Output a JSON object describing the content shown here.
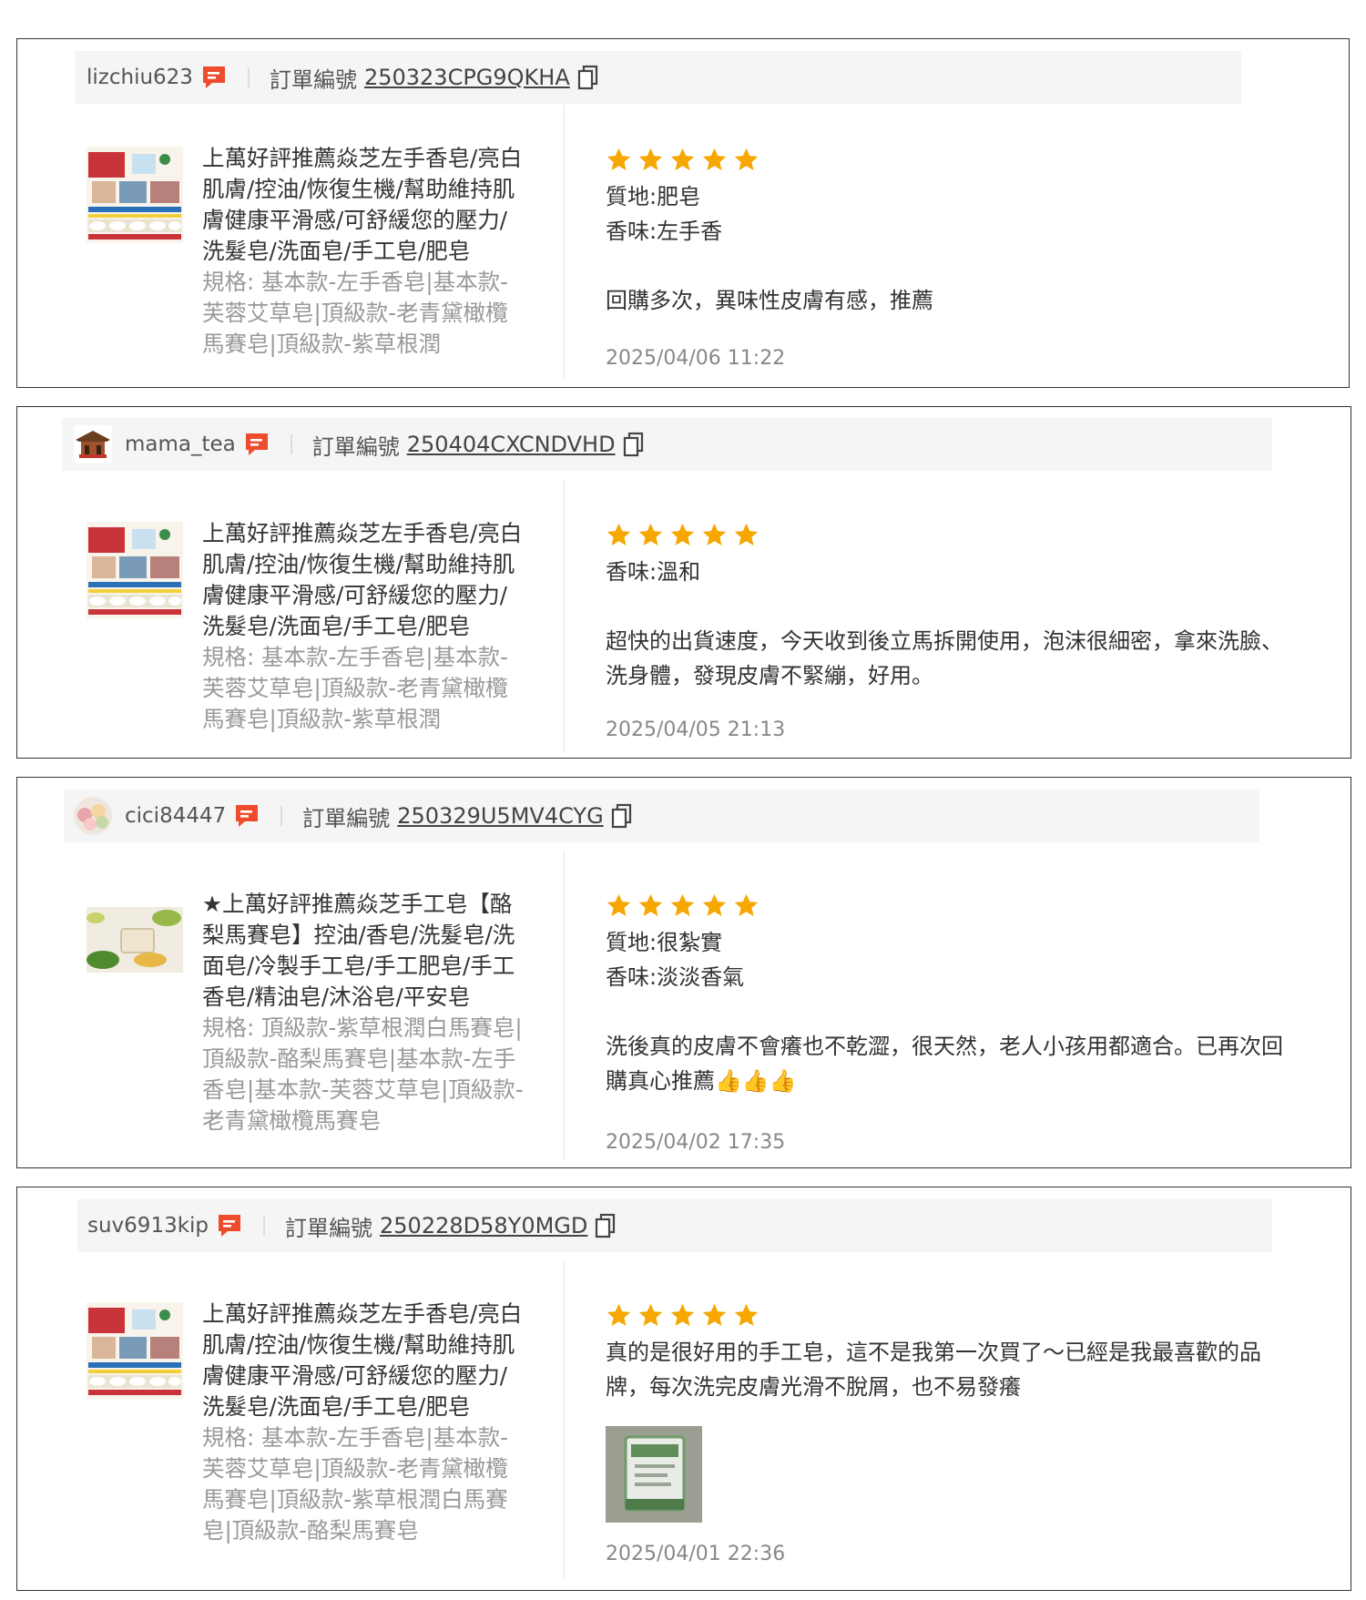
{
  "common": {
    "order_label": "訂單編號",
    "spec_prefix": "規格: "
  },
  "reviews": [
    {
      "username": "lizchiu623",
      "order_no": "250323CPG9QKHA",
      "product_title": "上萬好評推薦焱芝左手香皂/亮白肌膚/控油/恢復生機/幫助維持肌膚健康平滑感/可舒緩您的壓力/洗髮皂/洗面皂/手工皂/肥皂",
      "product_spec": "規格: 基本款-左手香皂|基本款-芙蓉艾草皂|頂級款-老青黛橄欖馬賽皂|頂級款-紫草根潤",
      "rating": 5,
      "attrs": [
        "質地:肥皂",
        "香味:左手香"
      ],
      "text": "回購多次，異味性皮膚有感，推薦",
      "date": "2025/04/06 11:22"
    },
    {
      "username": "mama_tea",
      "order_no": "250404CXCNDVHD",
      "product_title": "上萬好評推薦焱芝左手香皂/亮白肌膚/控油/恢復生機/幫助維持肌膚健康平滑感/可舒緩您的壓力/洗髮皂/洗面皂/手工皂/肥皂",
      "product_spec": "規格: 基本款-左手香皂|基本款-芙蓉艾草皂|頂級款-老青黛橄欖馬賽皂|頂級款-紫草根潤",
      "rating": 5,
      "attrs": [
        "香味:溫和"
      ],
      "text": "超快的出貨速度，今天收到後立馬拆開使用，泡沫很細密，拿來洗臉、洗身體，發現皮膚不緊繃，好用。",
      "date": "2025/04/05 21:13"
    },
    {
      "username": "cici84447",
      "order_no": "250329U5MV4CYG",
      "product_title": "★上萬好評推薦焱芝手工皂【酪梨馬賽皂】控油/香皂/洗髮皂/洗面皂/冷製手工皂/手工肥皂/手工香皂/精油皂/沐浴皂/平安皂",
      "product_spec": "規格: 頂級款-紫草根潤白馬賽皂|頂級款-酪梨馬賽皂|基本款-左手香皂|基本款-芙蓉艾草皂|頂級款-老青黛橄欖馬賽皂",
      "rating": 5,
      "attrs": [
        "質地:很紮實",
        "香味:淡淡香氣"
      ],
      "text": "洗後真的皮膚不會癢也不乾澀，很天然，老人小孩用都適合。已再次回購真心推薦👍👍👍",
      "date": "2025/04/02 17:35"
    },
    {
      "username": "suv6913kip",
      "order_no": "250228D58Y0MGD",
      "product_title": "上萬好評推薦焱芝左手香皂/亮白肌膚/控油/恢復生機/幫助維持肌膚健康平滑感/可舒緩您的壓力/洗髮皂/洗面皂/手工皂/肥皂",
      "product_spec": "規格: 基本款-左手香皂|基本款-芙蓉艾草皂|頂級款-老青黛橄欖馬賽皂|頂級款-紫草根潤白馬賽皂|頂級款-酪梨馬賽皂",
      "rating": 5,
      "attrs": [],
      "text": "真的是很好用的手工皂，這不是我第一次買了～已經是我最喜歡的品牌，每次洗完皮膚光滑不脫屑，也不易發癢",
      "date": "2025/04/01 22:36"
    }
  ],
  "colors": {
    "star": "#f6a700",
    "chat_icon": "#ee4d2d",
    "header_bg": "#f5f5f5",
    "muted_text": "#999999"
  }
}
